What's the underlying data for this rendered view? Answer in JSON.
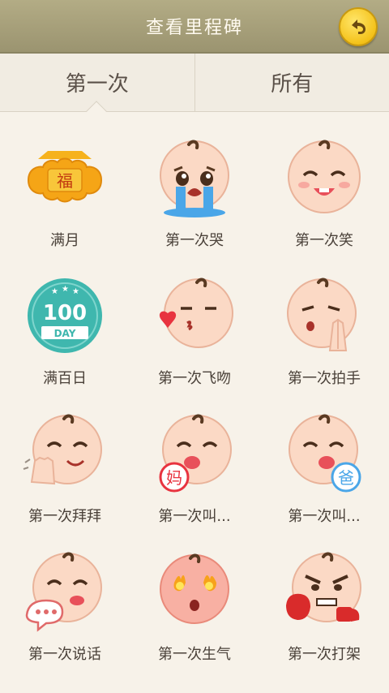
{
  "header": {
    "title": "查看里程碑"
  },
  "tabs": [
    {
      "label": "第一次",
      "active": true
    },
    {
      "label": "所有",
      "active": false
    }
  ],
  "badges": [
    {
      "label": "满月",
      "icon": "fu-badge-icon",
      "mark": "福"
    },
    {
      "label": "第一次哭",
      "icon": "crying-baby-icon"
    },
    {
      "label": "第一次笑",
      "icon": "laughing-baby-icon"
    },
    {
      "label": "满百日",
      "icon": "100-day-badge-icon",
      "mark_number": "100",
      "mark_text": "DAY"
    },
    {
      "label": "第一次飞吻",
      "icon": "kissing-baby-icon"
    },
    {
      "label": "第一次拍手",
      "icon": "clapping-baby-icon"
    },
    {
      "label": "第一次拜拜",
      "icon": "waving-baby-icon"
    },
    {
      "label": "第一次叫...",
      "icon": "baby-says-mom-icon",
      "mark": "妈"
    },
    {
      "label": "第一次叫...",
      "icon": "baby-says-dad-icon",
      "mark": "爸"
    },
    {
      "label": "第一次说话",
      "icon": "talking-baby-icon"
    },
    {
      "label": "第一次生气",
      "icon": "angry-baby-icon"
    },
    {
      "label": "第一次打架",
      "icon": "fighting-baby-icon"
    }
  ],
  "colors": {
    "header_bg": "#a8a17c",
    "back_button": "#f4c21a",
    "skin": "#fbd9c5",
    "teal_badge": "#3fb7ae"
  }
}
